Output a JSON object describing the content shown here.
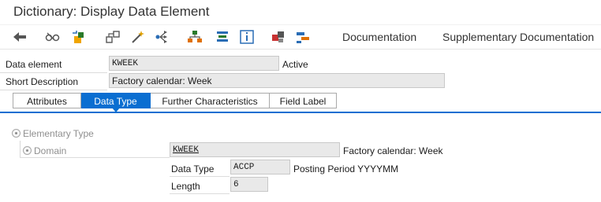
{
  "window": {
    "title": "Dictionary: Display Data Element"
  },
  "toolbar": {
    "documentation_label": "Documentation",
    "supplementary_label": "Supplementary Documentation"
  },
  "header": {
    "data_element_label": "Data element",
    "data_element_value": "KWEEK",
    "status": "Active",
    "short_description_label": "Short Description",
    "short_description_value": "Factory calendar: Week"
  },
  "tabs": [
    {
      "label": "Attributes",
      "active": false
    },
    {
      "label": "Data Type",
      "active": true
    },
    {
      "label": "Further Characteristics",
      "active": false
    },
    {
      "label": "Field Label",
      "active": false
    }
  ],
  "data_type_tab": {
    "elementary_type_label": "Elementary Type",
    "domain_label": "Domain",
    "domain_value": "KWEEK",
    "domain_description": "Factory calendar: Week",
    "data_type_label": "Data Type",
    "data_type_value": "ACCP",
    "data_type_description": "Posting Period YYYYMM",
    "length_label": "Length",
    "length_value": "6"
  },
  "colors": {
    "accent": "#0a6ed1",
    "field_bg": "#e9e9e9"
  }
}
